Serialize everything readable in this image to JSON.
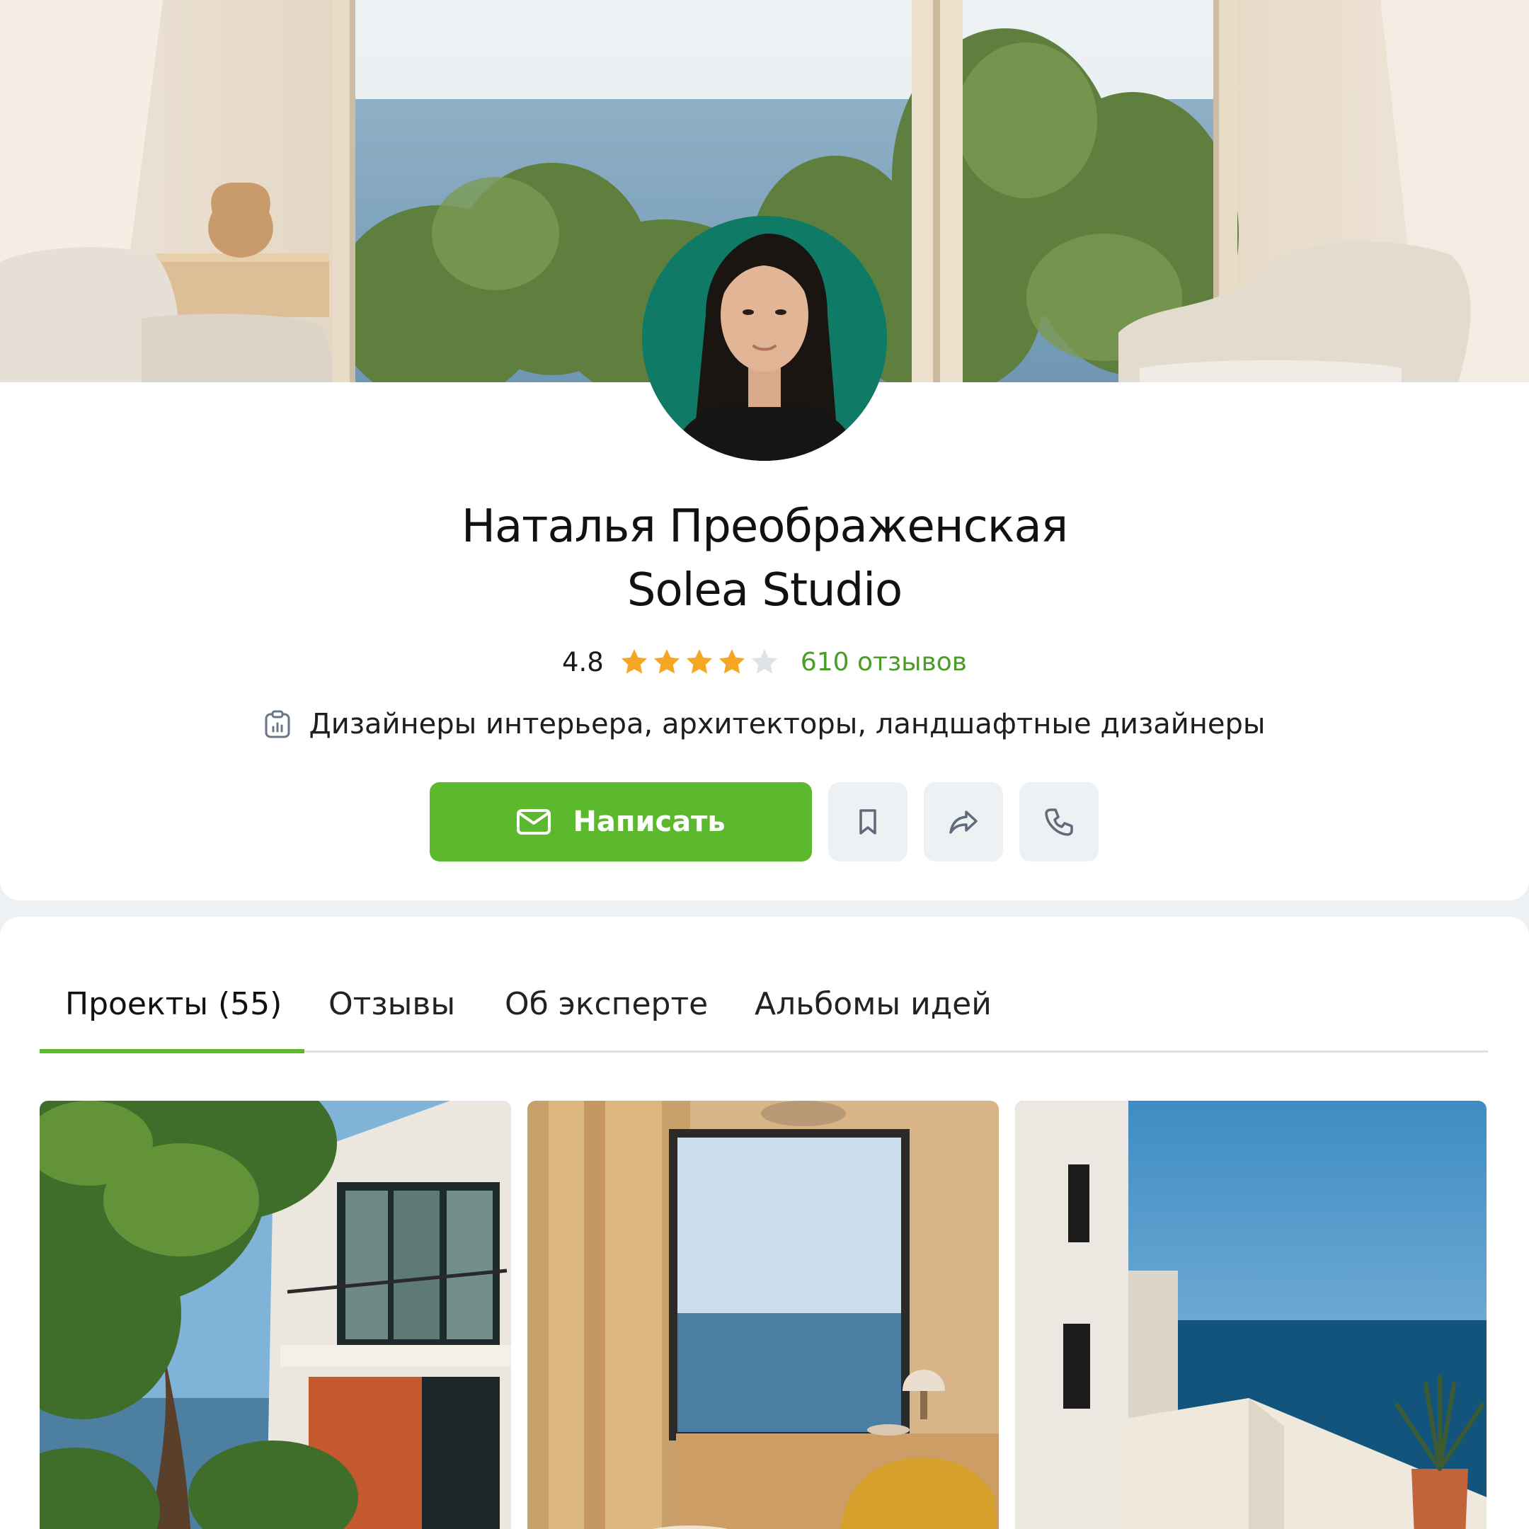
{
  "profile": {
    "name": "Наталья Преображенская",
    "company": "Solea Studio",
    "rating": "4.8",
    "rating_value": 4.8,
    "stars_filled": 4,
    "stars_total": 5,
    "reviews_link": "610 отзывов",
    "category": "Дизайнеры интерьера, архитекторы, ландшафтные дизайнеры",
    "category_icon": "clipboard-chart-icon",
    "cover_image": "interior-living-room-sea-view-photo",
    "avatar_image": "woman-portrait-photo"
  },
  "actions": {
    "write_label": "Написать",
    "write_icon": "mail-icon",
    "bookmark_icon": "bookmark-icon",
    "share_icon": "share-arrow-icon",
    "phone_icon": "phone-icon"
  },
  "tabs": [
    {
      "label": "Проекты (55)",
      "active": true
    },
    {
      "label": "Отзывы",
      "active": false
    },
    {
      "label": "Об эксперте",
      "active": false
    },
    {
      "label": "Альбомы идей",
      "active": false
    }
  ],
  "projects": [
    {
      "image": "modern-house-with-trees-photo"
    },
    {
      "image": "interior-window-sea-view-photo"
    },
    {
      "image": "white-house-terrace-sea-photo"
    }
  ],
  "colors": {
    "accent_green": "#5cb82d",
    "reviews_green": "#4a9e27",
    "star_filled": "#f5a623",
    "star_empty": "#dfe3e8",
    "button_gray": "#eef1f4",
    "page_background": "#eef1f4",
    "avatar_background": "#0f7a66"
  }
}
